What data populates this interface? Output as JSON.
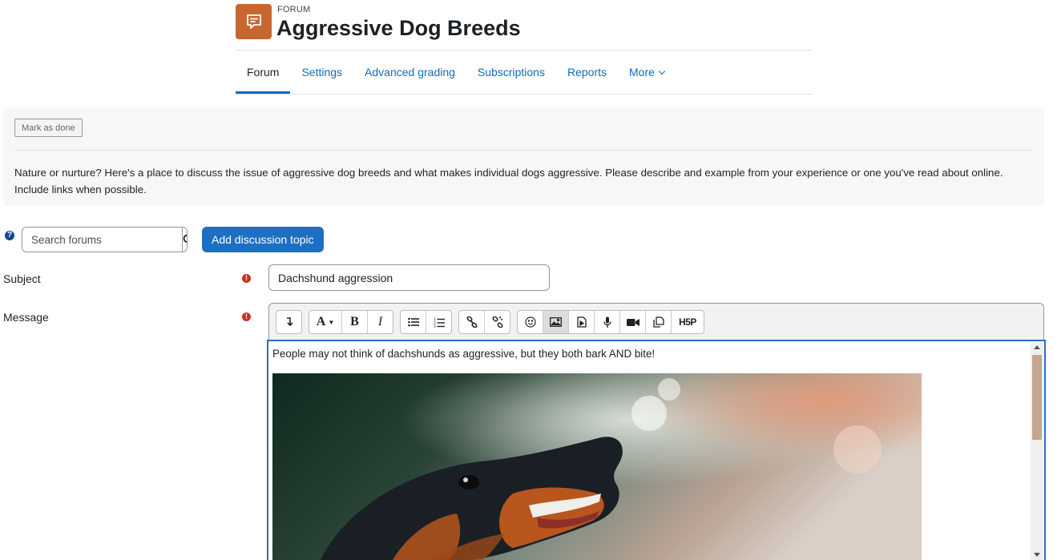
{
  "header": {
    "module_label": "FORUM",
    "title": "Aggressive Dog Breeds"
  },
  "nav": {
    "tabs": [
      "Forum",
      "Settings",
      "Advanced grading",
      "Subscriptions",
      "Reports",
      "More"
    ],
    "active": "Forum"
  },
  "activity": {
    "mark_done_label": "Mark as done",
    "intro": "Nature or nurture?  Here's a place to discuss the issue of aggressive dog breeds and what makes individual dogs aggressive. Please describe and example from your experience or one you've read about online. Include links when possible."
  },
  "search": {
    "placeholder": "Search forums",
    "value": ""
  },
  "add_discussion_label": "Add discussion topic",
  "form": {
    "subject_label": "Subject",
    "subject_value": "Dachshund aggression",
    "message_label": "Message",
    "message_text": "People may not think of dachshunds as aggressive, but they both bark AND bite!"
  },
  "toolbar_icons": [
    "collapse-icon",
    "font-style-icon",
    "bold-icon",
    "italic-icon",
    "unordered-list-icon",
    "ordered-list-icon",
    "link-icon",
    "unlink-icon",
    "emoji-icon",
    "image-icon",
    "media-icon",
    "record-audio-icon",
    "record-video-icon",
    "manage-files-icon",
    "h5p-icon"
  ],
  "colors": {
    "brand_blue": "#0f6cbf",
    "button_blue": "#1d6fc4",
    "forum_icon": "#c7662f",
    "required": "#ca3120",
    "editor_focus": "#2a6fc4"
  }
}
